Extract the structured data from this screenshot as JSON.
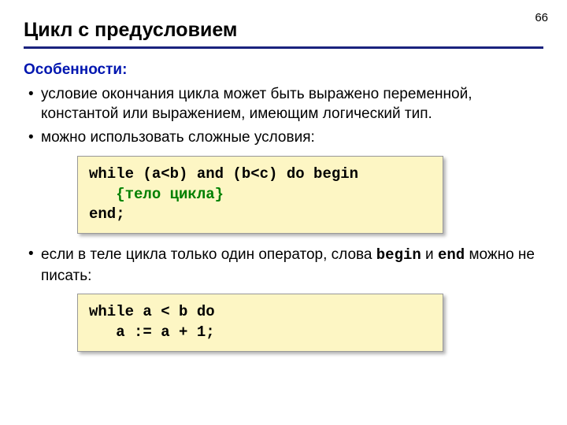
{
  "page_number": "66",
  "title": "Цикл с предусловием",
  "section_label": "Особенности:",
  "bullets": {
    "b1": "условие окончания цикла может быть выражено переменной, константой или выражением, имеющим логический тип.",
    "b2": "можно использовать сложные условия:",
    "b3_part1": "если в теле цикла только один оператор, слова ",
    "b3_begin": "begin",
    "b3_and": " и ",
    "b3_end": "end",
    "b3_part2": " можно не писать:"
  },
  "code1": {
    "line1": "while (a<b) and (b<c) do begin",
    "line2_indent": "   ",
    "line2_comment": "{тело цикла}",
    "line3": "end;"
  },
  "code2": {
    "line1": "while a < b do",
    "line2": "   a := a + 1;"
  }
}
